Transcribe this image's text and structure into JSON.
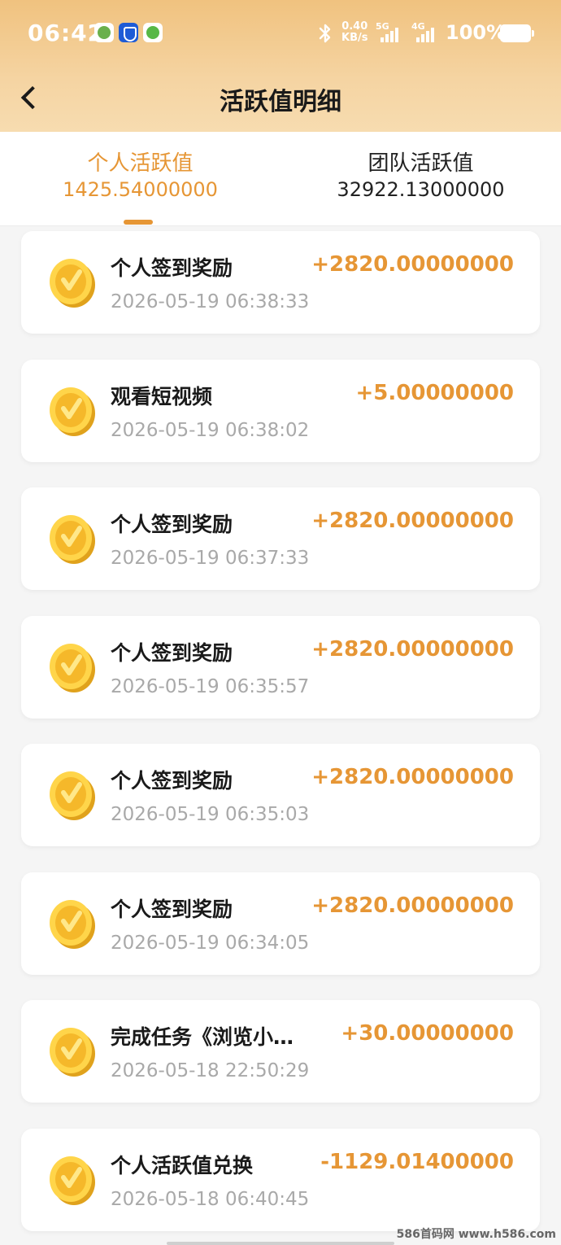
{
  "status_bar": {
    "time": "06:42",
    "net_speed_value": "0.40",
    "net_speed_unit": "KB/s",
    "sim1_label": "5G",
    "sim2_label": "4G",
    "battery": "100%"
  },
  "nav": {
    "title": "活跃值明细"
  },
  "tabs": [
    {
      "label": "个人活跃值",
      "value": "1425.54000000",
      "active": true
    },
    {
      "label": "团队活跃值",
      "value": "32922.13000000",
      "active": false
    }
  ],
  "records": [
    {
      "title": "个人签到奖励",
      "time": "2026-05-19 06:38:33",
      "amount": "+2820.00000000"
    },
    {
      "title": "观看短视频",
      "time": "2026-05-19 06:38:02",
      "amount": "+5.00000000"
    },
    {
      "title": "个人签到奖励",
      "time": "2026-05-19 06:37:33",
      "amount": "+2820.00000000"
    },
    {
      "title": "个人签到奖励",
      "time": "2026-05-19 06:35:57",
      "amount": "+2820.00000000"
    },
    {
      "title": "个人签到奖励",
      "time": "2026-05-19 06:35:03",
      "amount": "+2820.00000000"
    },
    {
      "title": "个人签到奖励",
      "time": "2026-05-19 06:34:05",
      "amount": "+2820.00000000"
    },
    {
      "title": "完成任务《浏览小…",
      "time": "2026-05-18 22:50:29",
      "amount": "+30.00000000"
    },
    {
      "title": "个人活跃值兑换",
      "time": "2026-05-18 06:40:45",
      "amount": "-1129.01400000"
    }
  ],
  "watermark": "586首码网 www.h586.com",
  "colors": {
    "accent": "#e69635",
    "header_gradient_top": "#f0c27f",
    "header_gradient_bottom": "#f7dcb0"
  }
}
